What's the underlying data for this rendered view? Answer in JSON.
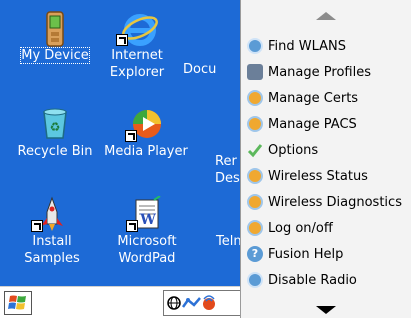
{
  "desktop": {
    "icons": [
      {
        "label": "My Device",
        "icon": "pda-icon"
      },
      {
        "label": "Internet\nExplorer",
        "icon": "internet-explorer-icon"
      },
      {
        "label": "Docu",
        "icon": "documents-icon"
      },
      {
        "label": "Recycle Bin",
        "icon": "recycle-bin-icon"
      },
      {
        "label": "Media Player",
        "icon": "media-player-icon"
      },
      {
        "label": "Rer\nDesk",
        "icon": "remote-desktop-icon"
      },
      {
        "label": "Install\nSamples",
        "icon": "install-samples-icon"
      },
      {
        "label": "Microsoft\nWordPad",
        "icon": "wordpad-icon"
      },
      {
        "label": "Teln",
        "icon": "telnet-icon"
      }
    ]
  },
  "menu": {
    "items": [
      {
        "label": "Find WLANS",
        "icon": "search-network-icon",
        "color": "#5b9bd5"
      },
      {
        "label": "Manage Profiles",
        "icon": "profiles-icon",
        "color": "#6b7f99"
      },
      {
        "label": "Manage Certs",
        "icon": "certificate-icon",
        "color": "#f0a830"
      },
      {
        "label": "Manage PACS",
        "icon": "pacs-icon",
        "color": "#f0a830"
      },
      {
        "label": "Options",
        "icon": "options-check-icon",
        "color": "#5cb85c"
      },
      {
        "label": "Wireless Status",
        "icon": "wireless-status-icon",
        "color": "#f0a830"
      },
      {
        "label": "Wireless Diagnostics",
        "icon": "wireless-diagnostics-icon",
        "color": "#f0a830"
      },
      {
        "label": "Log on/off",
        "icon": "logon-icon",
        "color": "#f0a830"
      },
      {
        "label": "Fusion Help",
        "icon": "help-icon",
        "color": "#5b9bd5"
      },
      {
        "label": "Disable Radio",
        "icon": "power-icon",
        "color": "#5b9bd5"
      }
    ]
  },
  "colors": {
    "desktop_bg": "#1d6ad6",
    "menu_bg": "#f3f3f3"
  }
}
